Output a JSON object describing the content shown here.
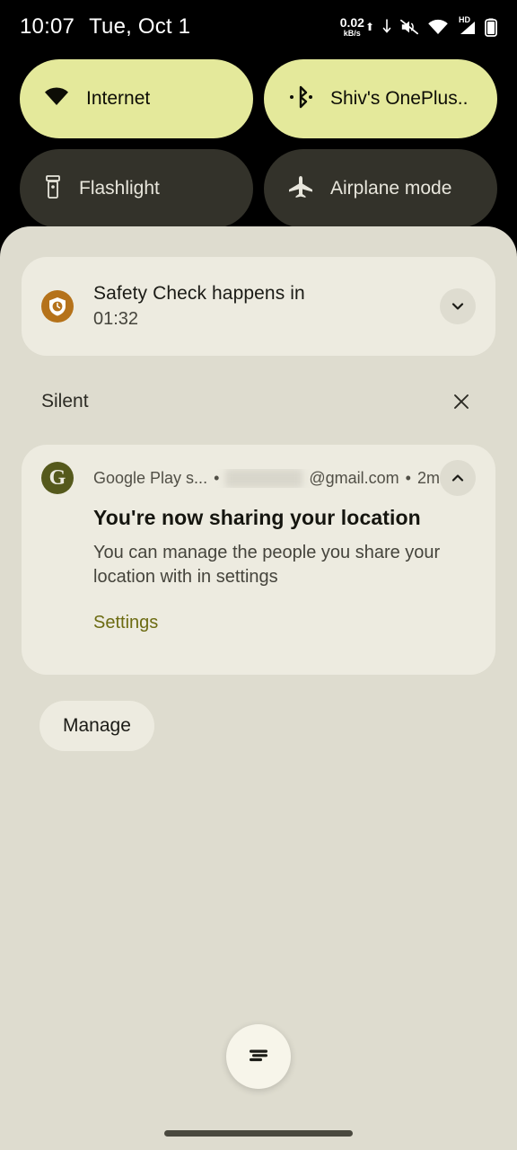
{
  "status_bar": {
    "time": "10:07",
    "date": "Tue, Oct 1",
    "network_speed_value": "0.02",
    "network_speed_unit": "kB/s",
    "icons": [
      "upload-arrow-icon",
      "download-arrow-icon",
      "volume-mute-icon",
      "wifi-icon",
      "hd-signal-icon",
      "cellular-signal-icon",
      "battery-icon"
    ],
    "hd_label": "HD"
  },
  "quick_settings": {
    "tiles": [
      {
        "label": "Internet",
        "icon": "wifi-icon",
        "state": "on"
      },
      {
        "label": "Shiv's OnePlus..",
        "icon": "bluetooth-icon",
        "state": "on"
      },
      {
        "label": "Flashlight",
        "icon": "flashlight-icon",
        "state": "off"
      },
      {
        "label": "Airplane mode",
        "icon": "airplane-icon",
        "state": "off"
      }
    ],
    "active_color": "#E4E99B",
    "inactive_color": "#33322A"
  },
  "shade": {
    "background_color": "#DEDCCF",
    "notification_color": "#EDEBE0"
  },
  "safety_notification": {
    "title": "Safety Check happens in",
    "subtitle": "01:32",
    "icon": "safety-shield-clock-icon",
    "icon_color": "#B5721A",
    "expand_icon": "chevron-down-icon"
  },
  "silent_section": {
    "label": "Silent",
    "clear_icon": "close-icon"
  },
  "play_notification": {
    "app_name": "Google Play s...",
    "app_icon": "google-play-services-icon",
    "app_icon_color": "#55591C",
    "separator": "•",
    "account_redacted": "",
    "account_domain": "@gmail.com",
    "time": "2m",
    "title": "You're now sharing your location",
    "body": "You can manage the people you share your location with in settings",
    "action_label": "Settings",
    "action_color": "#6C6B12",
    "collapse_icon": "chevron-up-icon"
  },
  "manage_button": {
    "label": "Manage"
  },
  "clear_all": {
    "icon": "clear-all-notifications-icon"
  }
}
